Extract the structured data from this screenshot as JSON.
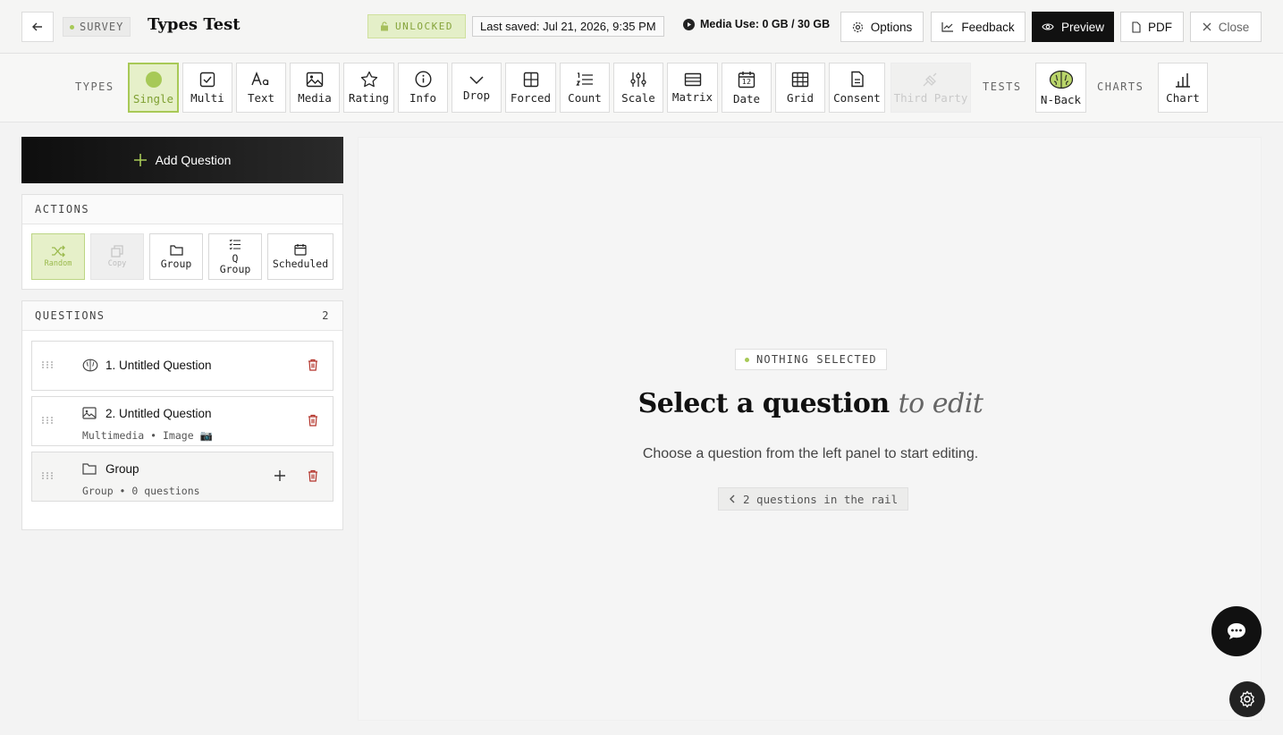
{
  "header": {
    "survey_badge": "SURVEY",
    "title": "Types Test",
    "lock_status": "UNLOCKED",
    "last_saved": "Last saved: Jul 21, 2026, 9:35 PM",
    "media_use": "Media Use: 0 GB / 30 GB",
    "buttons": {
      "options": "Options",
      "feedback": "Feedback",
      "preview": "Preview",
      "pdf": "PDF",
      "close": "Close"
    }
  },
  "toolbar": {
    "types_label": "TYPES",
    "tests_label": "TESTS",
    "charts_label": "CHARTS",
    "types": [
      {
        "label": "Single",
        "icon": "radio-circle-icon",
        "state": "active"
      },
      {
        "label": "Multi",
        "icon": "checkbox-icon"
      },
      {
        "label": "Text",
        "icon": "text-aa-icon"
      },
      {
        "label": "Media",
        "icon": "image-icon"
      },
      {
        "label": "Rating",
        "icon": "star-icon"
      },
      {
        "label": "Info",
        "icon": "info-icon"
      },
      {
        "label": "Drop",
        "icon": "chevron-down-icon"
      },
      {
        "label": "Forced",
        "icon": "forced-grid-icon"
      },
      {
        "label": "Count",
        "icon": "numbered-list-icon"
      },
      {
        "label": "Scale",
        "icon": "sliders-icon"
      },
      {
        "label": "Matrix",
        "icon": "matrix-icon"
      },
      {
        "label": "Date",
        "icon": "calendar-icon",
        "date_number": "12"
      },
      {
        "label": "Grid",
        "icon": "grid-icon"
      },
      {
        "label": "Consent",
        "icon": "document-icon"
      },
      {
        "label": "Third Party",
        "icon": "plug-icon",
        "state": "disabled"
      }
    ],
    "tests": [
      {
        "label": "N-Back",
        "icon": "brain-icon"
      }
    ],
    "charts": [
      {
        "label": "Chart",
        "icon": "bar-chart-icon"
      }
    ]
  },
  "left": {
    "add_question": "Add Question",
    "actions_title": "ACTIONS",
    "actions": [
      {
        "label": "Random",
        "icon": "shuffle-icon",
        "state": "active"
      },
      {
        "label": "Copy",
        "icon": "copy-icon",
        "state": "disabled"
      },
      {
        "label": "Group",
        "icon": "folder-icon"
      },
      {
        "label": "Q\nGroup",
        "icon": "list-check-icon"
      },
      {
        "label": "Scheduled",
        "icon": "calendar-icon"
      }
    ],
    "questions_title": "QUESTIONS",
    "questions_count": "2",
    "questions": [
      {
        "title": "1. Untitled Question",
        "subtitle": "",
        "icon": "brain-icon"
      },
      {
        "title": "2. Untitled Question",
        "subtitle": "Multimedia • Image 📷",
        "icon": "image-icon"
      },
      {
        "title": "Group",
        "subtitle": "Group • 0 questions",
        "icon": "folder-icon"
      }
    ]
  },
  "main": {
    "badge": "NOTHING SELECTED",
    "headline_main": "Select a question",
    "headline_em": "to edit",
    "subtitle": "Choose a question from the left panel to start editing.",
    "rail_hint": "2 questions in the rail"
  },
  "colors": {
    "accent_green": "#a8c956",
    "dark": "#111111",
    "danger": "#c0392b"
  }
}
